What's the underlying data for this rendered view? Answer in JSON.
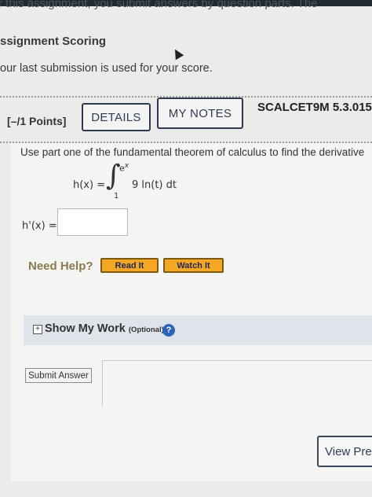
{
  "top_fragment": "r this assignment, you submit answers by question parts. The",
  "assignment_scoring": {
    "title": "ssignment Scoring",
    "description": "our last submission is used for your score."
  },
  "question": {
    "points": "[–/1 Points]",
    "details_label": "DETAILS",
    "my_notes_label": "MY NOTES",
    "code": "SCALCET9M 5.3.015",
    "prompt": "Use part one of the fundamental theorem of calculus to find the derivative",
    "function_lhs": "h(x) =",
    "upper_limit": "e",
    "upper_limit_exp": "x",
    "lower_limit": "1",
    "integrand": "9 ln(t) dt",
    "answer_label": "h'(x) =",
    "answer_value": ""
  },
  "help": {
    "need_help": "Need Help?",
    "read_it": "Read It",
    "watch_it": "Watch It"
  },
  "show_work": {
    "toggle_symbol": "+",
    "label": "Show My Work",
    "optional": "(Optional)",
    "help_symbol": "?"
  },
  "submit_label": "Submit Answer",
  "view_label": "View Pre",
  "colors": {
    "button_border": "#2d3b52",
    "orange_button": "#f5a623",
    "help_icon": "#2e64b8"
  }
}
